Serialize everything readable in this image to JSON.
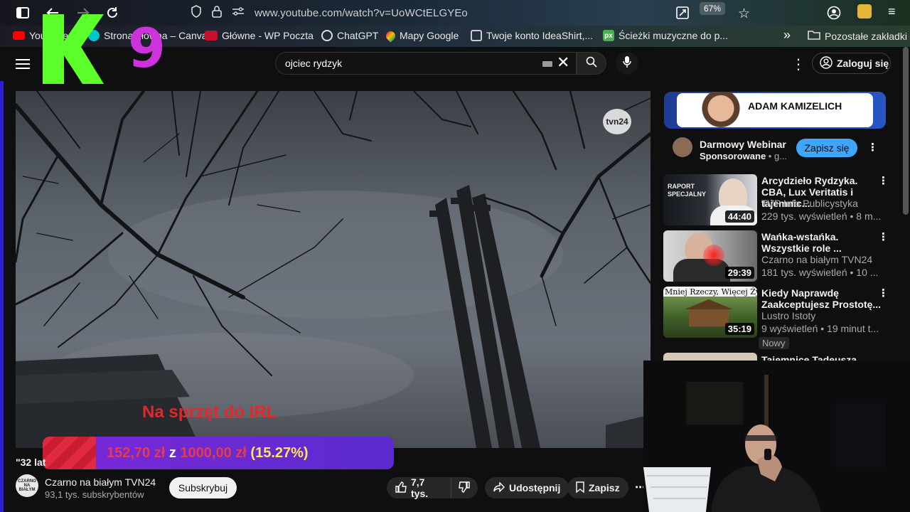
{
  "browser": {
    "url": "www.youtube.com/watch?v=UoWCtELGYEo",
    "zoom": "67%",
    "bookmarks": [
      {
        "label": "YouTube",
        "icon": "youtube-icon"
      },
      {
        "label": "Strona główna – Canva",
        "icon": "canva-icon"
      },
      {
        "label": "Główne - WP Poczta",
        "icon": "wp-icon"
      },
      {
        "label": "ChatGPT",
        "icon": "chatgpt-icon"
      },
      {
        "label": "Mapy Google",
        "icon": "maps-icon"
      },
      {
        "label": "Twoje konto IdeaShirt,...",
        "icon": "ideashirt-icon"
      },
      {
        "label": "Ścieżki muzyczne do p...",
        "icon": "px-icon"
      }
    ],
    "other_bookmarks": "Pozostałe zakładki"
  },
  "overlay": {
    "logo_letter": "K",
    "logo_number": "9",
    "irl_text": "Na sprzęt do IRL",
    "goal_current": "152,70 zł",
    "goal_sep": "z",
    "goal_target": "1000,00 zł",
    "goal_percent": "(15.27%)",
    "goal_fraction": 0.1527
  },
  "header": {
    "search_value": "ojciec rydzyk",
    "signin_label": "Zaloguj się"
  },
  "video": {
    "title": "\"32 lat",
    "channel_logo_text": "CZARNO NA BIAŁYM",
    "channel_name": "Czarno na białym TVN24",
    "subscribers": "93,1 tys. subskrybentów",
    "subscribe_label": "Subskrybuj",
    "likes": "7,7 tys.",
    "share_label": "Udostępnij",
    "save_label": "Zapisz",
    "watermark": "tvn24"
  },
  "sidebar": {
    "ad": {
      "banner_name": "ADAM KAMIZELICH",
      "title": "Darmowy Webinar",
      "sponsored": "Sponsorowane",
      "sponsored_suffix": " • g...",
      "button": "Zapisz się"
    },
    "recommendations": [
      {
        "title": "Arcydzieło Rydzyka. CBA, Lux Veritatis i tajemnic...",
        "channel": "TVP Info Publicystyka",
        "meta": "229 tys. wyświetleń • 8 m...",
        "duration": "44:40",
        "thumb_text": "RAPORT SPECJALNY"
      },
      {
        "title": "Wańka-wstańka. Wszystkie role ...",
        "channel": "Czarno na białym TVN24",
        "meta": "181 tys. wyświetleń • 10 ...",
        "duration": "29:39",
        "thumb_text": ""
      },
      {
        "title": "Kiedy Naprawdę Zaakceptujesz Prostotę...",
        "channel": "Lustro Istoty",
        "meta": "9 wyświetleń • 19 minut t...",
        "duration": "35:19",
        "thumb_text": "Mniej Rzeczy, Więcej Życia",
        "badge": "Nowy"
      },
      {
        "title": "Tajemnice Tadeusza",
        "channel": "",
        "meta": "",
        "duration": "",
        "thumb_text": ""
      }
    ]
  }
}
